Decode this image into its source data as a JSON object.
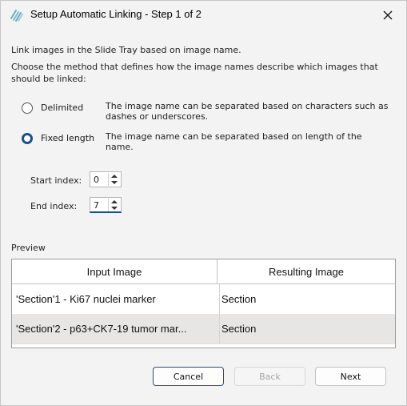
{
  "window": {
    "title": "Setup Automatic Linking - Step 1 of 2"
  },
  "intro": {
    "line1": "Link images in the Slide Tray based on image name.",
    "line2a": "Choose the method that defines how the image names describe which images that",
    "line2b": "should be linked:"
  },
  "methods": [
    {
      "label": "Delimited",
      "selected": false,
      "desc1": "The image name can be separated based on characters such as",
      "desc2": "dashes or underscores."
    },
    {
      "label": "Fixed length",
      "selected": true,
      "desc1": "The image name can be separated based on length of the",
      "desc2": "name."
    }
  ],
  "indices": {
    "start_label": "Start index:",
    "start_value": "0",
    "end_label": "End index:",
    "end_value": "7"
  },
  "preview": {
    "label": "Preview",
    "columns": [
      "Input Image",
      "Resulting Image"
    ],
    "rows": [
      [
        "'Section'1 - Ki67 nuclei marker",
        "Section"
      ],
      [
        "'Section'2 - p63+CK7-19 tumor mar...",
        "Section"
      ]
    ]
  },
  "buttons": {
    "cancel": "Cancel",
    "back": "Back",
    "next": "Next"
  },
  "colors": {
    "accent": "#1f4f8a",
    "icon": "#6aaeb8"
  }
}
